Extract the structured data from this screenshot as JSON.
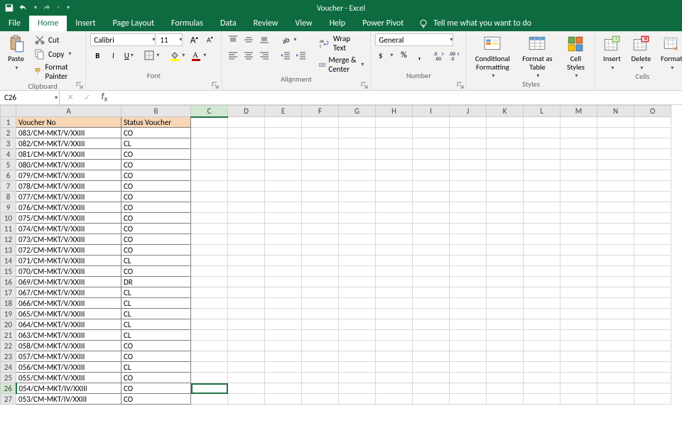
{
  "title": "Voucher  -  Excel",
  "tabs": {
    "file": "File",
    "home": "Home",
    "insert": "Insert",
    "page_layout": "Page Layout",
    "formulas": "Formulas",
    "data": "Data",
    "review": "Review",
    "view": "View",
    "help": "Help",
    "power_pivot": "Power Pivot",
    "tell_me": "Tell me what you want to do"
  },
  "ribbon": {
    "clipboard": {
      "label": "Clipboard",
      "paste": "Paste",
      "cut": "Cut",
      "copy": "Copy",
      "format_painter": "Format Painter"
    },
    "font": {
      "label": "Font",
      "name": "Calibri",
      "size": "11"
    },
    "alignment": {
      "label": "Alignment",
      "wrap": "Wrap Text",
      "merge": "Merge & Center"
    },
    "number": {
      "label": "Number",
      "format": "General"
    },
    "styles": {
      "label": "Styles",
      "cond": "Conditional\nFormatting",
      "table": "Format as\nTable",
      "cell": "Cell\nStyles"
    },
    "cells": {
      "label": "Cells",
      "insert": "Insert",
      "delete": "Delete",
      "format": "Format"
    }
  },
  "namebox": "C26",
  "columns": [
    "A",
    "B",
    "C",
    "D",
    "E",
    "F",
    "G",
    "H",
    "I",
    "J",
    "K",
    "L",
    "M",
    "N",
    "O"
  ],
  "header_row": {
    "A": "Voucher No",
    "B": "Status Voucher"
  },
  "chart_data": {
    "type": "table",
    "columns": [
      "Voucher No",
      "Status Voucher"
    ],
    "rows": [
      [
        "083/CM-MKT/V/XXIII",
        "CO"
      ],
      [
        "082/CM-MKT/V/XXIII",
        "CL"
      ],
      [
        "081/CM-MKT/V/XXIII",
        "CO"
      ],
      [
        "080/CM-MKT/V/XXIII",
        "CO"
      ],
      [
        "079/CM-MKT/V/XXIII",
        "CO"
      ],
      [
        "078/CM-MKT/V/XXIII",
        "CO"
      ],
      [
        "077/CM-MKT/V/XXIII",
        "CO"
      ],
      [
        "076/CM-MKT/V/XXIII",
        "CO"
      ],
      [
        "075/CM-MKT/V/XXIII",
        "CO"
      ],
      [
        "074/CM-MKT/V/XXIII",
        "CO"
      ],
      [
        "073/CM-MKT/V/XXIII",
        "CO"
      ],
      [
        "072/CM-MKT/V/XXIII",
        "CO"
      ],
      [
        "071/CM-MKT/V/XXIII",
        "CL"
      ],
      [
        "070/CM-MKT/V/XXIII",
        "CO"
      ],
      [
        "069/CM-MKT/V/XXIII",
        "DR"
      ],
      [
        "067/CM-MKT/V/XXIII",
        "CL"
      ],
      [
        "066/CM-MKT/V/XXIII",
        "CL"
      ],
      [
        "065/CM-MKT/V/XXIII",
        "CL"
      ],
      [
        "064/CM-MKT/V/XXIII",
        "CL"
      ],
      [
        "063/CM-MKT/V/XXIII",
        "CL"
      ],
      [
        "058/CM-MKT/V/XXIII",
        "CO"
      ],
      [
        "057/CM-MKT/V/XXIII",
        "CO"
      ],
      [
        "056/CM-MKT/V/XXIII",
        "CL"
      ],
      [
        "055/CM-MKT/V/XXIII",
        "CO"
      ],
      [
        "054/CM-MKT/IV/XXIII",
        "CO"
      ],
      [
        "053/CM-MKT/IV/XXIII",
        "CO"
      ]
    ]
  },
  "selection": {
    "cell": "C26",
    "row": 26,
    "col": "C"
  }
}
